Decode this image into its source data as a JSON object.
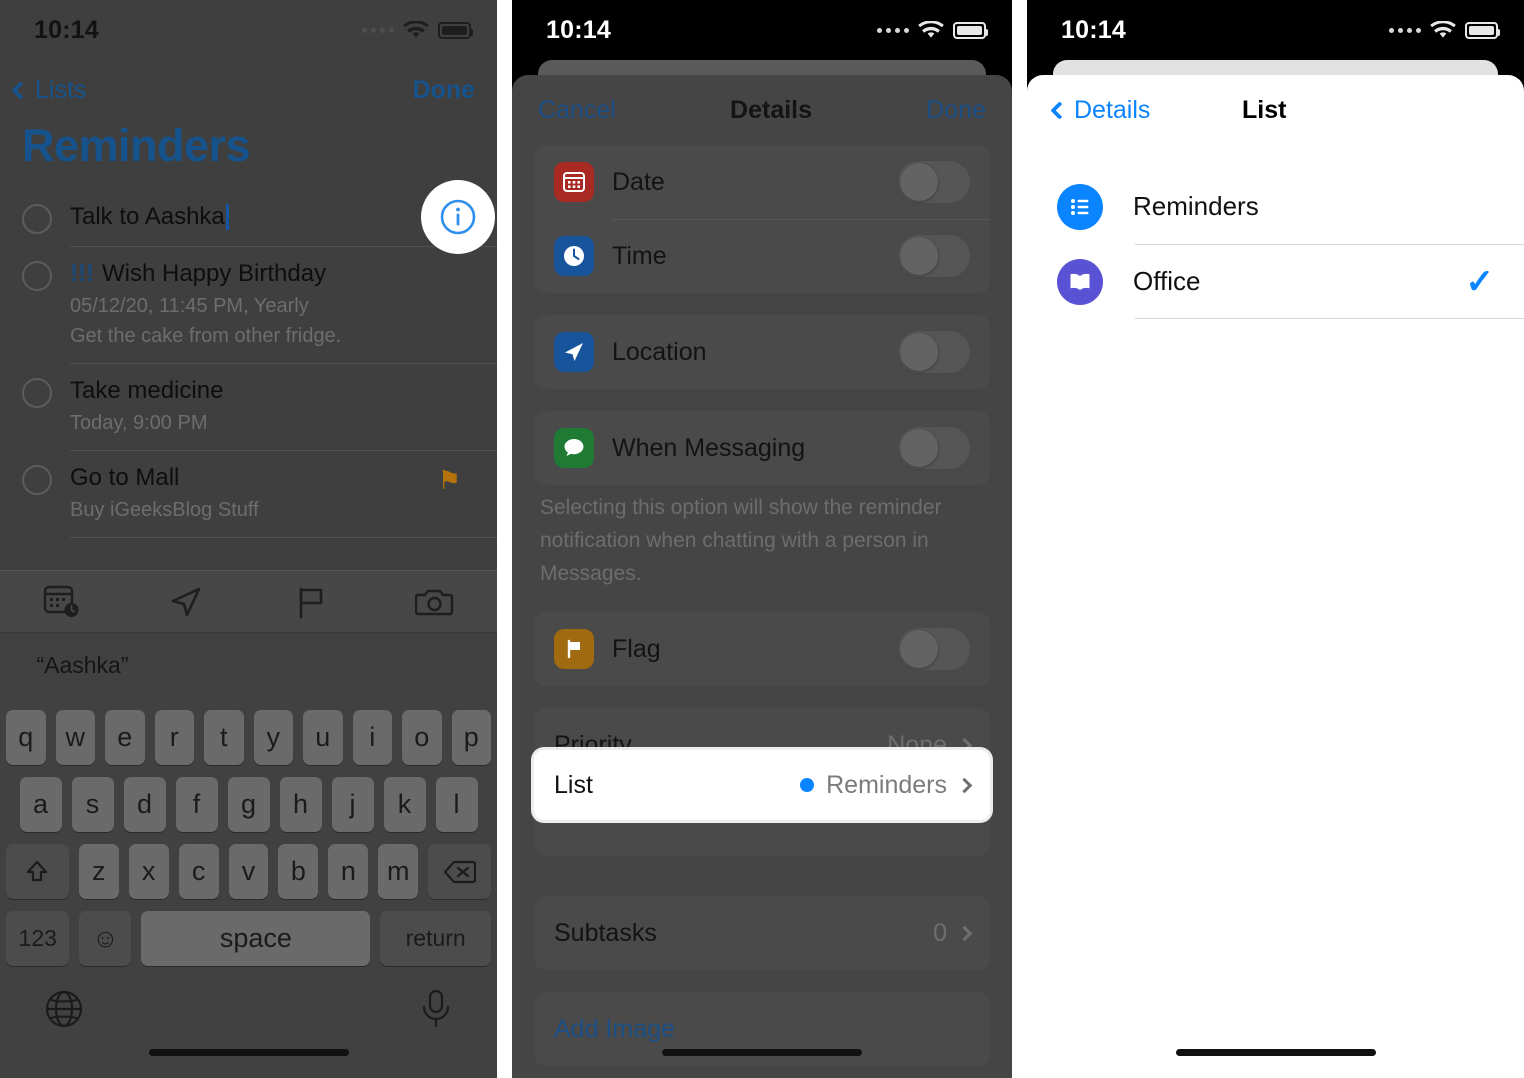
{
  "status_bar": {
    "time": "10:14",
    "wifi_icon": "wifi-icon",
    "battery_icon": "battery-icon",
    "signal_icon": "signal-dots-icon"
  },
  "panel1": {
    "nav": {
      "back_label": "Lists",
      "back_icon": "chevron-left-icon",
      "done_label": "Done"
    },
    "title": "Reminders",
    "info_button_icon": "info-circle-icon",
    "reminders": [
      {
        "bang": "",
        "title": "Talk to Aashka",
        "editing": true,
        "sub1": "",
        "sub2": "",
        "flagged": false
      },
      {
        "bang": "!!!",
        "title": "Wish Happy Birthday",
        "editing": false,
        "sub1": "05/12/20, 11:45 PM, Yearly",
        "sub2": "Get the cake from other fridge.",
        "flagged": false
      },
      {
        "bang": "",
        "title": "Take medicine",
        "editing": false,
        "sub1": "Today, 9:00 PM",
        "sub2": "",
        "flagged": false
      },
      {
        "bang": "",
        "title": "Go to Mall",
        "editing": false,
        "sub1": "Buy iGeeksBlog Stuff",
        "sub2": "",
        "flagged": true
      }
    ],
    "toolbar": [
      {
        "icon": "calendar-clock-icon"
      },
      {
        "icon": "location-arrow-icon"
      },
      {
        "icon": "flag-outline-icon"
      },
      {
        "icon": "camera-icon"
      }
    ],
    "suggestions": [
      "“Aashka”",
      "",
      ""
    ],
    "keyboard": {
      "row1": [
        "q",
        "w",
        "e",
        "r",
        "t",
        "y",
        "u",
        "i",
        "o",
        "p"
      ],
      "row2": [
        "a",
        "s",
        "d",
        "f",
        "g",
        "h",
        "j",
        "k",
        "l"
      ],
      "row3": [
        "z",
        "x",
        "c",
        "v",
        "b",
        "n",
        "m"
      ],
      "shift_icon": "shift-up-icon",
      "backspace_icon": "backspace-icon",
      "numbers_label": "123",
      "emoji_icon": "emoji-smiley-icon",
      "space_label": "space",
      "return_label": "return",
      "globe_icon": "globe-icon",
      "mic_icon": "microphone-icon"
    }
  },
  "panel2": {
    "nav": {
      "cancel_label": "Cancel",
      "title": "Details",
      "done_label": "Done"
    },
    "rows": [
      {
        "label": "Date",
        "icon": "calendar-icon",
        "icon_color": "#a82a22",
        "toggle": false
      },
      {
        "label": "Time",
        "icon": "clock-icon",
        "icon_color": "#18549c",
        "toggle": false
      },
      {
        "label": "Location",
        "icon": "location-arrow-icon",
        "icon_color": "#18549c",
        "toggle": false
      },
      {
        "label": "When Messaging",
        "icon": "messages-bubble-icon",
        "icon_color": "#1f7a34",
        "toggle": false
      },
      {
        "label": "Flag",
        "icon": "flag-icon",
        "icon_color": "#a06a10",
        "toggle": false
      }
    ],
    "footnote": "Selecting this option will show the reminder notification when chatting with a person in Messages.",
    "priority": {
      "label": "Priority",
      "value": "None",
      "chevron_icon": "chevron-right-icon"
    },
    "list": {
      "label": "List",
      "value": "Reminders",
      "dot_color": "#0a84ff",
      "chevron_icon": "chevron-right-icon",
      "highlighted": true
    },
    "subtasks": {
      "label": "Subtasks",
      "value": "0",
      "chevron_icon": "chevron-right-icon"
    },
    "add_image": {
      "label": "Add Image"
    }
  },
  "panel3": {
    "nav": {
      "back_label": "Details",
      "back_icon": "chevron-left-icon",
      "title": "List"
    },
    "lists": [
      {
        "label": "Reminders",
        "icon": "bulleted-list-icon",
        "icon_color": "#0a84ff",
        "selected": false
      },
      {
        "label": "Office",
        "icon": "open-book-icon",
        "icon_color": "#5a52d5",
        "selected": true
      }
    ],
    "check_icon": "checkmark-icon"
  }
}
